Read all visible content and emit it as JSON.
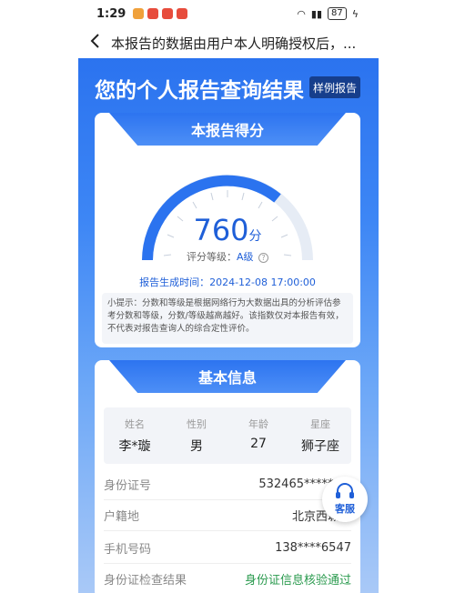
{
  "status": {
    "time": "1:29",
    "battery": "87"
  },
  "nav": {
    "back_icon": "chevron-left-icon",
    "title": "本报告的数据由用户本人明确授权后，..."
  },
  "hero": {
    "title": "您的个人报告查询结果",
    "sample_button": "样例报告"
  },
  "score_card": {
    "header": "本报告得分",
    "score": "760",
    "score_unit": "分",
    "grade_label": "评分等级：",
    "grade_value": "A级",
    "help_icon": "question-circle-icon",
    "gen_time": "报告生成时间：2024-12-08 17:00:00",
    "tip": "小提示：分数和等级是根据网络行为大数据出具的分析评估参考分数和等级，分数/等级越高越好。该指数仅对本报告有效，不代表对报告查询人的综合定性评价。"
  },
  "info_card": {
    "header": "基本信息",
    "summary": [
      {
        "label": "姓名",
        "value": "李*璇"
      },
      {
        "label": "性别",
        "value": "男"
      },
      {
        "label": "年龄",
        "value": "27"
      },
      {
        "label": "星座",
        "value": "狮子座"
      }
    ],
    "rows": [
      {
        "label": "身份证号",
        "value": "532465********"
      },
      {
        "label": "户籍地",
        "value": "北京西城区"
      },
      {
        "label": "手机号码",
        "value": "138****6547"
      },
      {
        "label": "身份证检查结果",
        "value": "身份证信息核验通过"
      }
    ]
  },
  "customer_service": {
    "label": "客服",
    "icon": "headset-icon"
  },
  "colors": {
    "brand": "#2b73ef",
    "success": "#2a9a4e"
  }
}
